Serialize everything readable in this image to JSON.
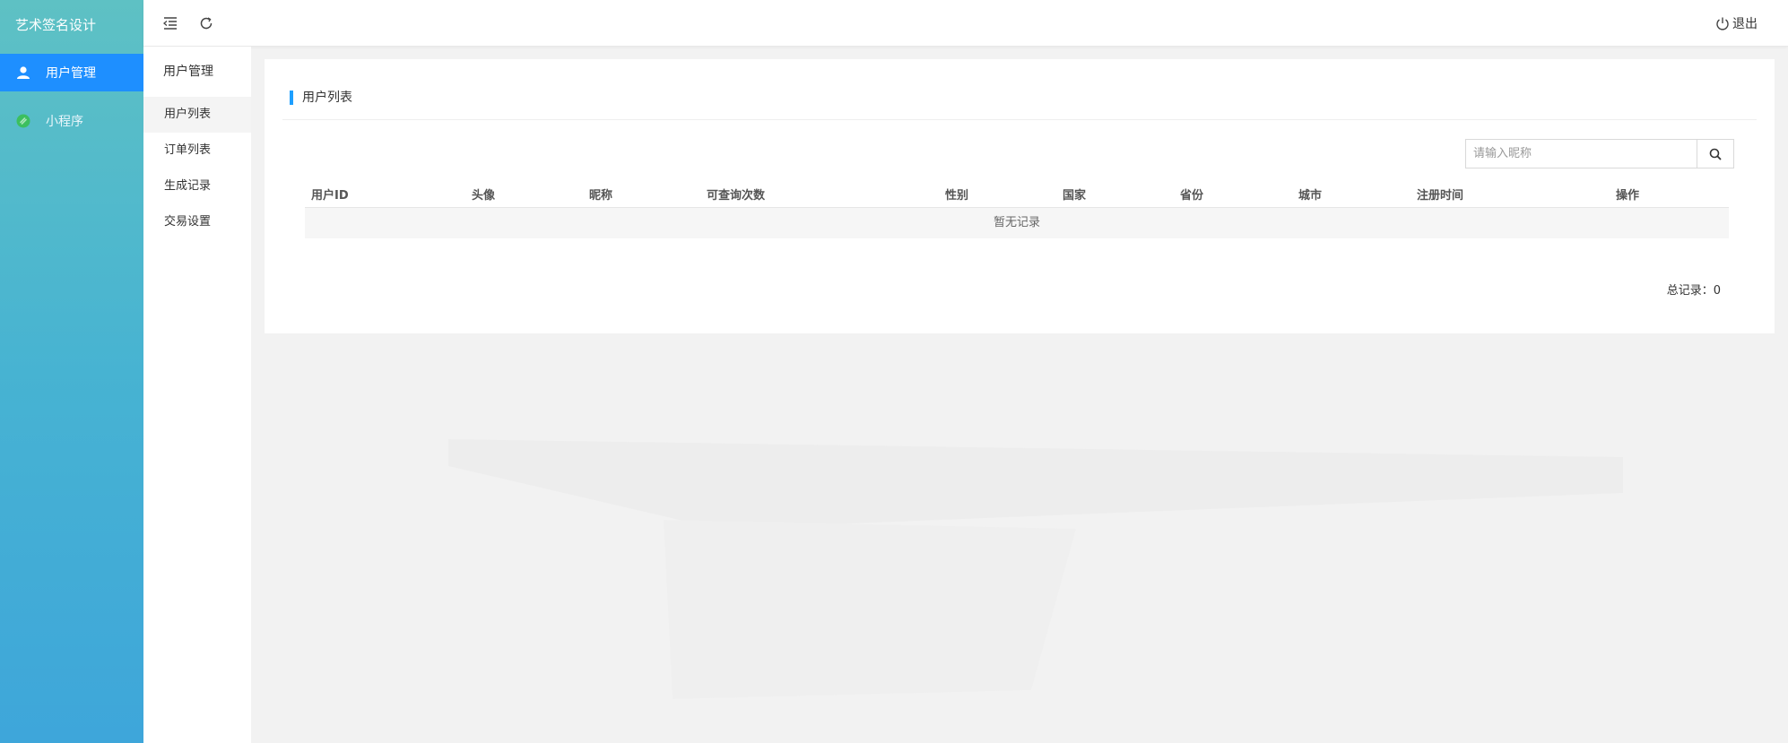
{
  "brand": "艺术签名设计",
  "sidebar": {
    "items": [
      {
        "label": "用户管理",
        "icon": "user-icon",
        "active": true
      },
      {
        "label": "小程序",
        "icon": "link-icon",
        "active": false
      }
    ]
  },
  "header": {
    "menu_toggle_icon": "menu-fold-icon",
    "refresh_icon": "refresh-icon",
    "logout_label": "退出"
  },
  "submenu": {
    "title": "用户管理",
    "items": [
      {
        "label": "用户列表",
        "active": true
      },
      {
        "label": "订单列表",
        "active": false
      },
      {
        "label": "生成记录",
        "active": false
      },
      {
        "label": "交易设置",
        "active": false
      }
    ]
  },
  "main": {
    "card_title": "用户列表",
    "search": {
      "placeholder": "请输入昵称",
      "value": ""
    },
    "table": {
      "columns": [
        "用户ID",
        "头像",
        "昵称",
        "可查询次数",
        "性别",
        "国家",
        "省份",
        "城市",
        "注册时间",
        "操作"
      ],
      "empty_text": "暂无记录"
    },
    "total_label": "总记录：0"
  },
  "colors": {
    "accent": "#1e9fff",
    "sidebar_active": "#1e8fff",
    "sidebar_gradient_top": "#5ec1c4",
    "sidebar_gradient_bottom": "#3ea6da",
    "link_icon": "#3cbf5f"
  }
}
